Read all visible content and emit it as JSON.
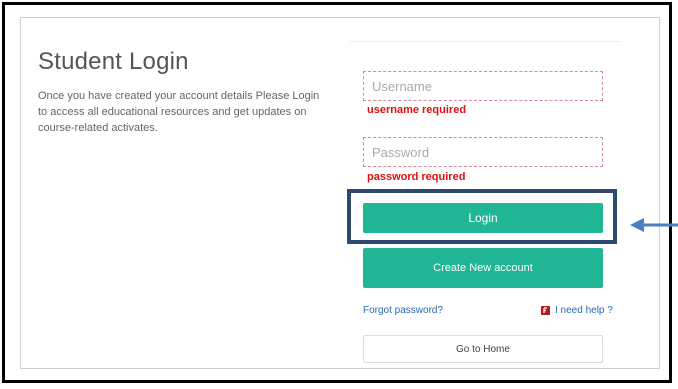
{
  "login": {
    "title": "Student Login",
    "description": "Once you have created your account details Please Login to access all educational resources and get updates on course-related activates.",
    "username_placeholder": "Username",
    "username_error": "username required",
    "password_placeholder": "Password",
    "password_error": "password required",
    "login_label": "Login",
    "create_account_label": "Create New account",
    "forgot_password_label": "Forgot password?",
    "help_label": "I need help ?",
    "home_label": "Go to Home"
  },
  "colors": {
    "primary_button": "#1fb595",
    "error_text": "#e01010",
    "link": "#2a6ab5",
    "highlight_border": "#2d4a6e",
    "arrow": "#4a7fc1",
    "help_icon": "#b01b1b"
  },
  "icons": {
    "help": "help-icon",
    "annotation": "left-arrow-icon"
  }
}
